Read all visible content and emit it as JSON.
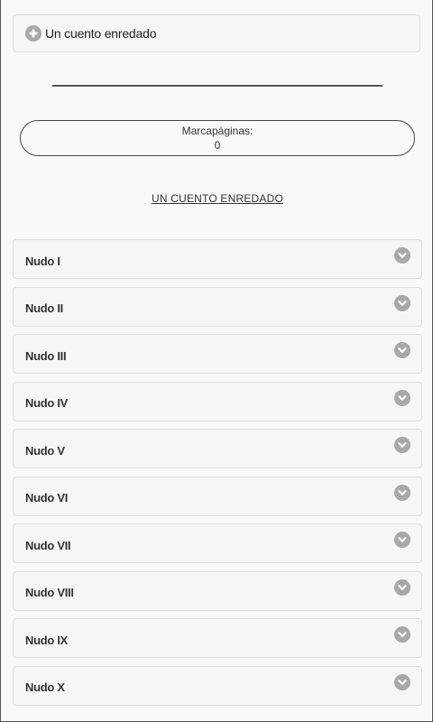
{
  "header": {
    "title": "Un cuento enredado",
    "icon": "plus-circle-icon"
  },
  "bookmark": {
    "label": "Marcapáginas:",
    "value": "0"
  },
  "story_link": "UN CUENTO ENREDADO",
  "nodes": [
    {
      "label": "Nudo I",
      "icon": "chevron-down-icon"
    },
    {
      "label": "Nudo II",
      "icon": "chevron-down-icon"
    },
    {
      "label": "Nudo III",
      "icon": "chevron-down-icon"
    },
    {
      "label": "Nudo IV",
      "icon": "chevron-down-icon"
    },
    {
      "label": "Nudo V",
      "icon": "chevron-down-icon"
    },
    {
      "label": "Nudo VI",
      "icon": "chevron-down-icon"
    },
    {
      "label": "Nudo VII",
      "icon": "chevron-down-icon"
    },
    {
      "label": "Nudo VIII",
      "icon": "chevron-down-icon"
    },
    {
      "label": "Nudo IX",
      "icon": "chevron-down-icon"
    },
    {
      "label": "Nudo X",
      "icon": "chevron-down-icon"
    }
  ],
  "colors": {
    "icon_bg": "#a8a8a8",
    "panel_bg": "#f6f6f6",
    "page_bg": "#f9f9f9"
  }
}
